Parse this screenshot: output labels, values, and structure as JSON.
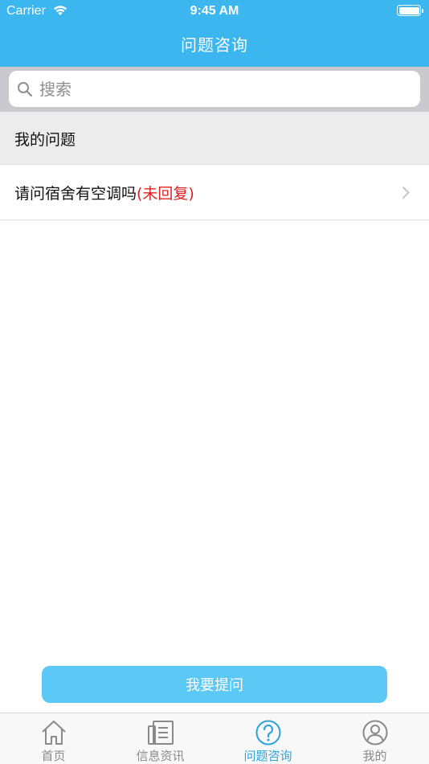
{
  "status_bar": {
    "carrier": "Carrier",
    "time": "9:45 AM"
  },
  "nav": {
    "title": "问题咨询"
  },
  "search": {
    "placeholder": "搜索",
    "value": ""
  },
  "section": {
    "title": "我的问题"
  },
  "questions": [
    {
      "text": "请问宿舍有空调吗",
      "status": "(未回复)"
    }
  ],
  "ask_button": {
    "label": "我要提问"
  },
  "tabs": [
    {
      "label": "首页",
      "icon": "home-icon",
      "active": false
    },
    {
      "label": "信息资讯",
      "icon": "news-icon",
      "active": false
    },
    {
      "label": "问题咨询",
      "icon": "question-icon",
      "active": true
    },
    {
      "label": "我的",
      "icon": "profile-icon",
      "active": false
    }
  ],
  "colors": {
    "nav_bg": "#3cb6ee",
    "button_bg": "#5bc8f5",
    "unreplied": "#e02020",
    "tab_active": "#2aa3dd",
    "tab_inactive": "#8a8a8a"
  }
}
